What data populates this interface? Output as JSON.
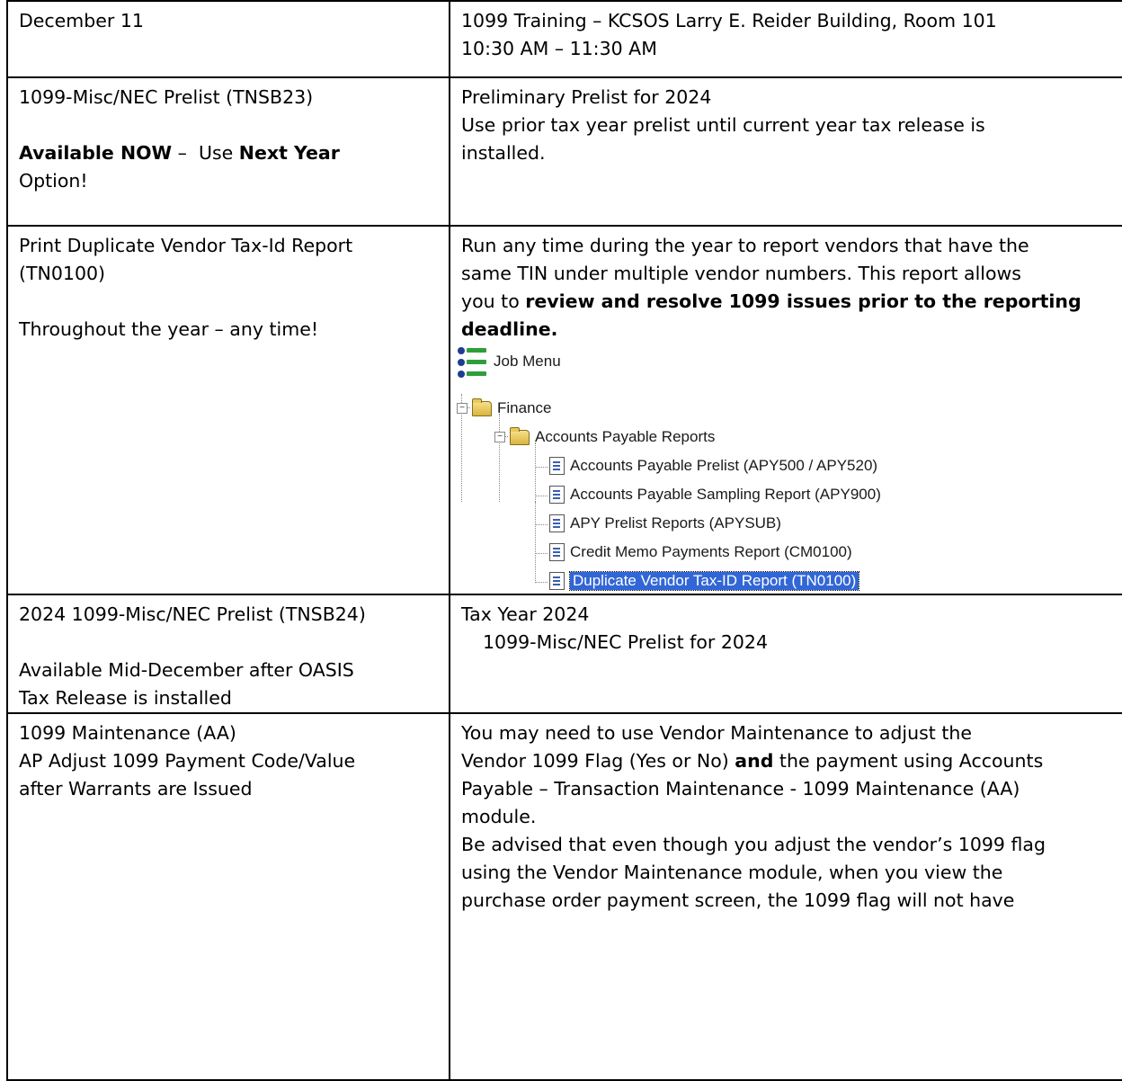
{
  "rows": [
    {
      "left": [
        "December 11"
      ],
      "right": [
        "1099 Training – KCSOS Larry E. Reider Building, Room 101",
        "10:30 AM – 11:30 AM"
      ]
    },
    {
      "left_line1": "1099-Misc/NEC Prelist (TNSB23)",
      "left_bold1": "Available NOW",
      "left_mid": " –  Use ",
      "left_bold2": "Next Year",
      "left_tail": "Option!",
      "right": [
        "Preliminary Prelist for 2024",
        "Use prior tax year prelist until current year tax release is",
        "installed."
      ]
    },
    {
      "left": [
        "Print Duplicate Vendor Tax-Id Report",
        "(TN0100)",
        "Throughout the year – any time!"
      ],
      "right_lines": [
        "Run any time during the year to report vendors that have the",
        "same TIN under multiple vendor numbers.  This report allows"
      ],
      "right_l3_plain": "you to ",
      "right_l3_bold": "review and resolve 1099 issues prior to the reporting",
      "right_l4_bold": "deadline.",
      "tree": {
        "root": "Job Menu",
        "finance": "Finance",
        "ap_reports": "Accounts Payable Reports",
        "items": [
          "Accounts Payable Prelist (APY500 / APY520)",
          "Accounts Payable Sampling Report (APY900)",
          "APY Prelist Reports (APYSUB)",
          "Credit Memo Payments Report (CM0100)",
          "Duplicate Vendor Tax-ID Report (TN0100)"
        ]
      }
    },
    {
      "left": [
        "2024 1099-Misc/NEC Prelist (TNSB24)",
        "Available Mid-December after OASIS",
        "Tax Release is installed"
      ],
      "right": [
        "Tax Year 2024",
        "1099-Misc/NEC Prelist for 2024"
      ]
    },
    {
      "left": [
        "1099 Maintenance (AA)",
        "AP Adjust 1099 Payment Code/Value",
        "after Warrants are Issued"
      ],
      "right_l1": "You may need to use Vendor Maintenance to adjust the",
      "right_l2_plain": "Vendor 1099 Flag (Yes or No) ",
      "right_l2_bold": "and",
      "right_l2_tail": " the payment using Accounts",
      "right_rest": [
        "Payable – Transaction Maintenance - 1099 Maintenance (AA)",
        "module.",
        "Be advised that even though you adjust the vendor’s 1099 flag",
        "using the Vendor Maintenance module, when you view the",
        "purchase order payment screen, the 1099 flag will not have"
      ]
    }
  ]
}
